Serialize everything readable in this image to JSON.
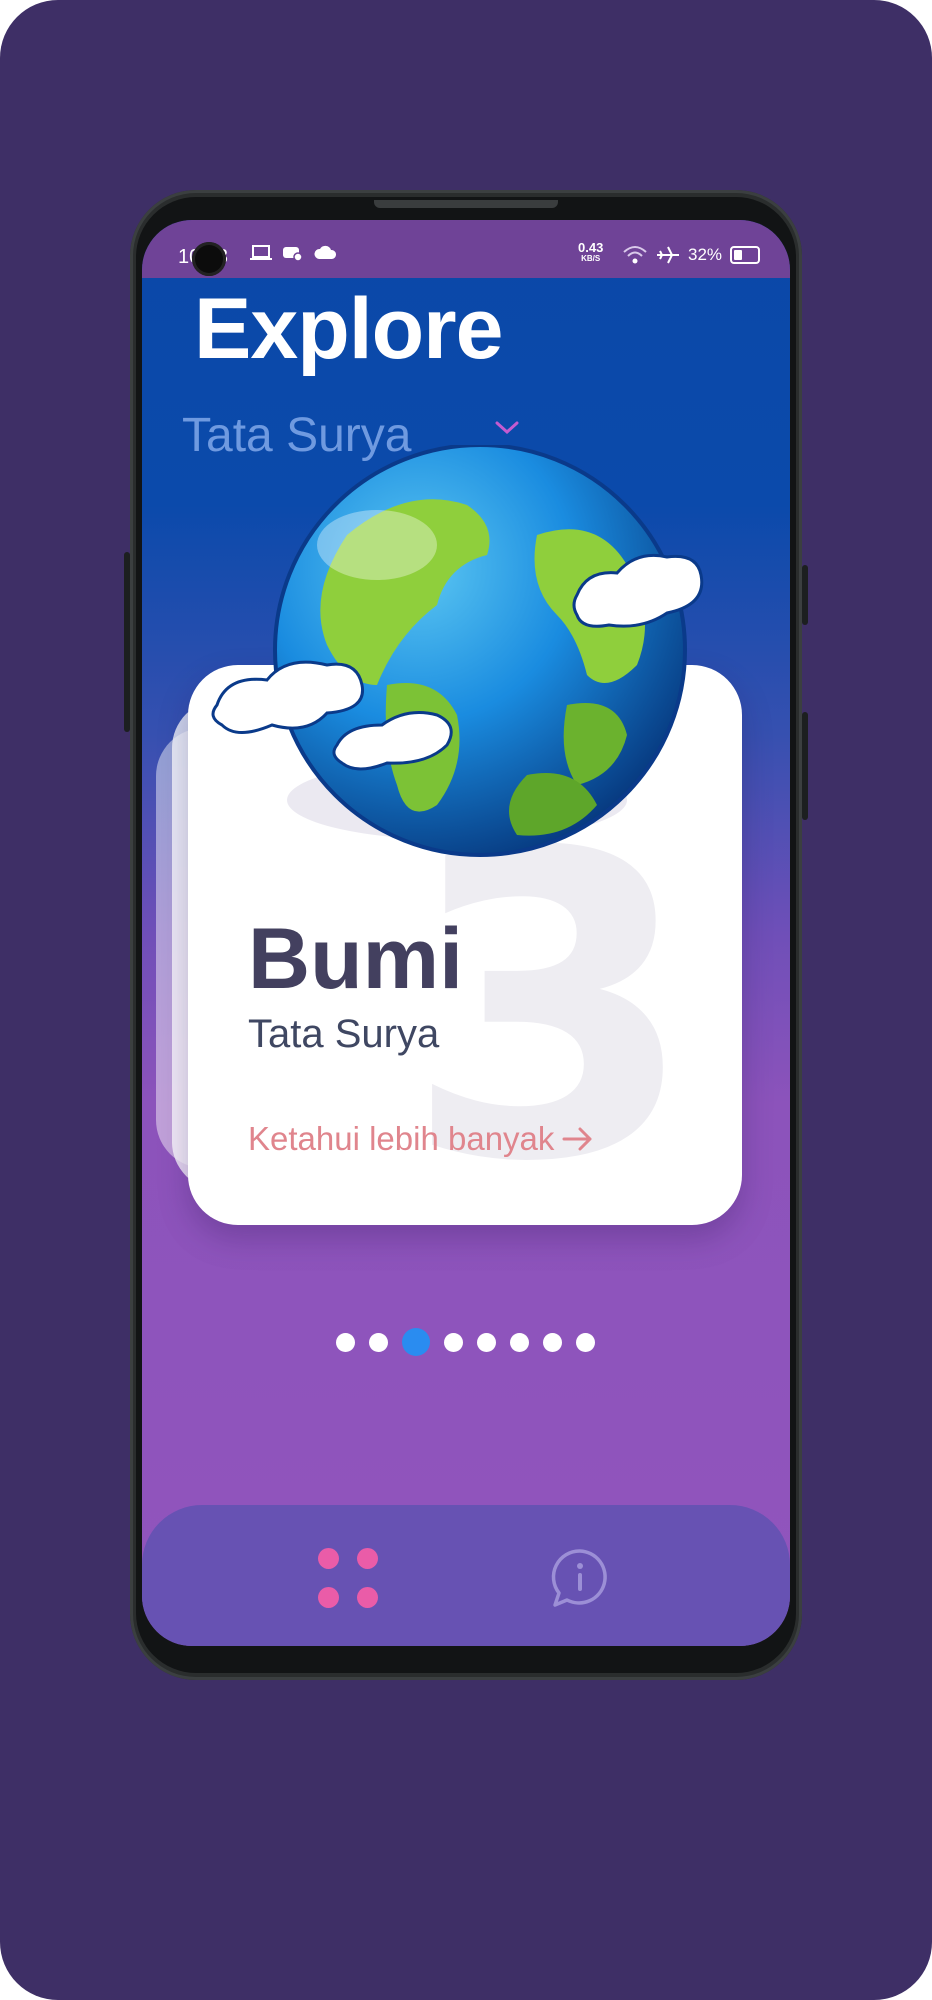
{
  "status_bar": {
    "time": "10:33",
    "net_speed_value": "0.43",
    "net_speed_unit": "KB/S",
    "battery_percent": "32%"
  },
  "header": {
    "title": "Explore",
    "category_dropdown": "Tata Surya"
  },
  "card": {
    "number": "3",
    "title": "Bumi",
    "subtitle": "Tata Surya",
    "link_label": "Ketahui lebih banyak"
  },
  "pager": {
    "total": 8,
    "active_index": 2
  },
  "bottom_nav": {
    "items": [
      {
        "icon": "grid-icon",
        "active": true
      },
      {
        "icon": "info-chat-icon",
        "active": false
      }
    ]
  },
  "colors": {
    "accent_pink": "#ea5ca8",
    "active_dot": "#2a8cf0",
    "link": "#e0858d"
  }
}
